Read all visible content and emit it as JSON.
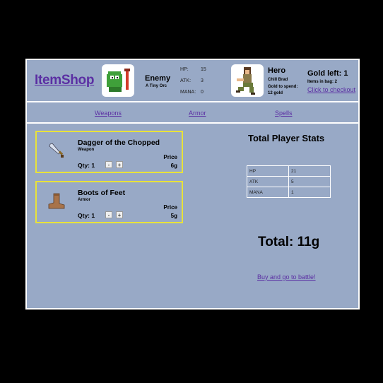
{
  "app": {
    "logo": "ItemShop"
  },
  "enemy": {
    "portrait_icon": "orc-portrait-icon",
    "title": "Enemy",
    "subtitle": "A Tiny Orc",
    "stats": [
      {
        "label": "HP:",
        "value": "15"
      },
      {
        "label": "ATK:",
        "value": "3"
      },
      {
        "label": "MANA:",
        "value": "0"
      }
    ]
  },
  "hero": {
    "portrait_icon": "hero-portrait-icon",
    "title": "Hero",
    "name": "Chill Brad",
    "gold_to_spend_label": "Gold to spend:",
    "gold_to_spend_value": "12 gold"
  },
  "gold": {
    "left_label": "Gold left: 1",
    "bag_label": "Items in bag: 2",
    "checkout_link": "Click to checkout"
  },
  "nav": {
    "tabs": [
      "Weapons",
      "Armor",
      "Spells"
    ]
  },
  "items": [
    {
      "icon": "dagger-icon",
      "name": "Dagger of the Chopped",
      "type": "Weapon",
      "price_label": "Price",
      "price": "6g",
      "qty_label": "Qty: 1",
      "minus": "-",
      "plus": "+"
    },
    {
      "icon": "boots-icon",
      "name": "Boots of Feet",
      "type": "Armor",
      "price_label": "Price",
      "price": "5g",
      "qty_label": "Qty: 1",
      "minus": "-",
      "plus": "+"
    }
  ],
  "player_stats": {
    "title": "Total Player Stats",
    "rows": [
      {
        "label": "HP",
        "value": "21"
      },
      {
        "label": "ATK",
        "value": "5"
      },
      {
        "label": "MANA",
        "value": "1"
      }
    ]
  },
  "total": {
    "label": "Total: 11g"
  },
  "battle_link": "Buy and go to battle!",
  "colors": {
    "background": "#98a9c6",
    "link": "#5b2fa3",
    "card_border": "#e8e23a",
    "outer": "#000000"
  }
}
